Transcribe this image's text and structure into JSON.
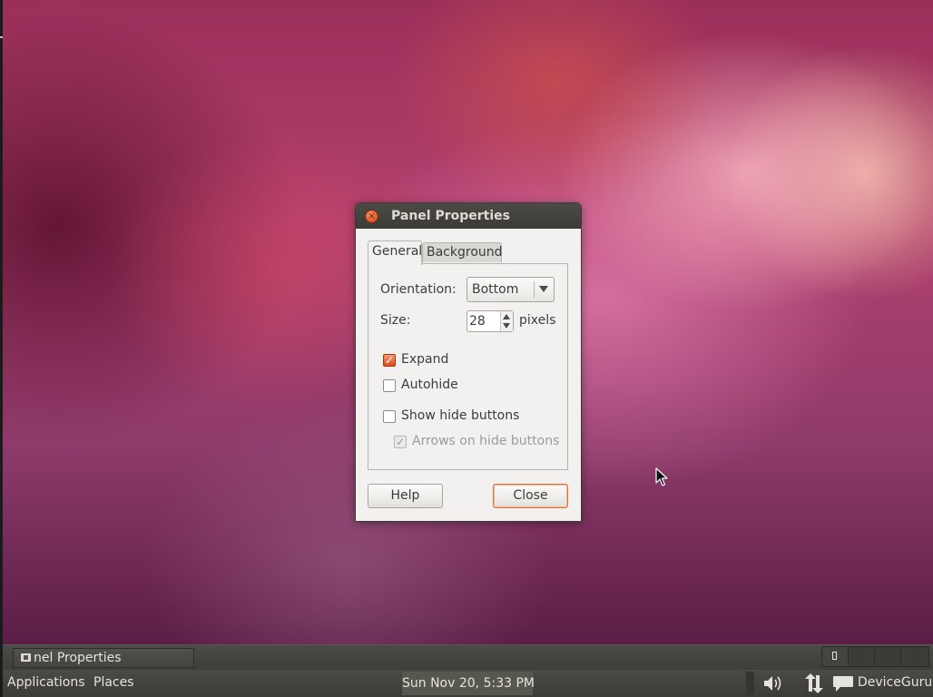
{
  "dialog": {
    "title": "Panel Properties",
    "tabs": [
      {
        "label": "General",
        "active": true
      },
      {
        "label": "Background",
        "active": false
      }
    ],
    "orientation": {
      "label": "Orientation:",
      "value": "Bottom"
    },
    "size": {
      "label": "Size:",
      "value": "28",
      "unit": "pixels"
    },
    "checkboxes": [
      {
        "label": "Expand",
        "checked": true,
        "enabled": true
      },
      {
        "label": "Autohide",
        "checked": false,
        "enabled": true
      },
      {
        "label": "Show hide buttons",
        "checked": false,
        "enabled": true
      },
      {
        "label": "Arrows on hide buttons",
        "checked": true,
        "enabled": false
      }
    ],
    "buttons": {
      "help": "Help",
      "close": "Close"
    },
    "accent_color": "#dd4c14"
  },
  "taskbar": {
    "task_label": "nel Properties"
  },
  "panel": {
    "applications": "Applications",
    "places": "Places",
    "clock": "Sun Nov 20,  5:33 PM",
    "user": "DeviceGuru",
    "tray_icons": [
      "volume-icon",
      "network-arrows-icon",
      "chat-bubble-icon"
    ]
  }
}
